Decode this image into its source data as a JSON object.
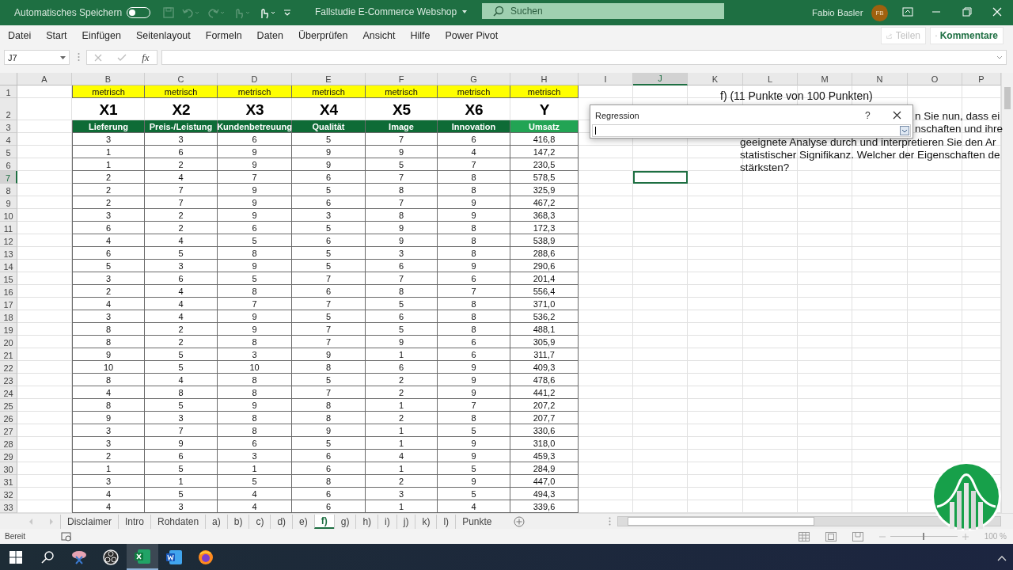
{
  "title_bar": {
    "autosave_label": "Automatisches Speichern",
    "autosave_on": false,
    "document_title": "Fallstudie E-Commerce Webshop",
    "search_placeholder": "Suchen",
    "user_name": "Fabio Basler",
    "user_initials": "FB"
  },
  "menu": [
    "Datei",
    "Start",
    "Einfügen",
    "Seitenlayout",
    "Formeln",
    "Daten",
    "Überprüfen",
    "Ansicht",
    "Hilfe",
    "Power Pivot"
  ],
  "share_button": {
    "label": "Teilen",
    "disabled": true
  },
  "comments_button": {
    "label": "Kommentare"
  },
  "formula_bar": {
    "name_box": "J7",
    "function_label": "fx"
  },
  "columns": [
    {
      "label": "A",
      "selected": false
    },
    {
      "label": "B",
      "selected": false
    },
    {
      "label": "C",
      "selected": false
    },
    {
      "label": "D",
      "selected": false
    },
    {
      "label": "E",
      "selected": false
    },
    {
      "label": "F",
      "selected": false
    },
    {
      "label": "G",
      "selected": false
    },
    {
      "label": "H",
      "selected": false
    },
    {
      "label": "I",
      "selected": false
    },
    {
      "label": "J",
      "selected": true
    },
    {
      "label": "K",
      "selected": false
    },
    {
      "label": "L",
      "selected": false
    },
    {
      "label": "M",
      "selected": false
    },
    {
      "label": "N",
      "selected": false
    },
    {
      "label": "O",
      "selected": false
    },
    {
      "label": "P",
      "selected": false
    }
  ],
  "rows": [
    {
      "label": "1",
      "selected": false
    },
    {
      "label": "2",
      "selected": false
    },
    {
      "label": "3",
      "selected": false
    },
    {
      "label": "4",
      "selected": false
    },
    {
      "label": "5",
      "selected": false
    },
    {
      "label": "6",
      "selected": false
    },
    {
      "label": "7",
      "selected": true
    },
    {
      "label": "8",
      "selected": false
    },
    {
      "label": "9",
      "selected": false
    },
    {
      "label": "10",
      "selected": false
    },
    {
      "label": "11",
      "selected": false
    },
    {
      "label": "12",
      "selected": false
    },
    {
      "label": "13",
      "selected": false
    },
    {
      "label": "14",
      "selected": false
    },
    {
      "label": "15",
      "selected": false
    },
    {
      "label": "16",
      "selected": false
    },
    {
      "label": "17",
      "selected": false
    },
    {
      "label": "18",
      "selected": false
    },
    {
      "label": "19",
      "selected": false
    },
    {
      "label": "20",
      "selected": false
    },
    {
      "label": "21",
      "selected": false
    },
    {
      "label": "22",
      "selected": false
    },
    {
      "label": "23",
      "selected": false
    },
    {
      "label": "24",
      "selected": false
    },
    {
      "label": "25",
      "selected": false
    },
    {
      "label": "26",
      "selected": false
    },
    {
      "label": "27",
      "selected": false
    },
    {
      "label": "28",
      "selected": false
    },
    {
      "label": "29",
      "selected": false
    },
    {
      "label": "30",
      "selected": false
    },
    {
      "label": "31",
      "selected": false
    },
    {
      "label": "32",
      "selected": false
    },
    {
      "label": "33",
      "selected": false
    }
  ],
  "table": {
    "scales": [
      "metrisch",
      "metrisch",
      "metrisch",
      "metrisch",
      "metrisch",
      "metrisch",
      "metrisch"
    ],
    "variables": [
      "X1",
      "X2",
      "X3",
      "X4",
      "X5",
      "X6",
      "Y"
    ],
    "headers": [
      {
        "label": "Lieferung",
        "color": "#0e6b36"
      },
      {
        "label": "Preis-/Leistung",
        "color": "#0e6b36"
      },
      {
        "label": "Kundenbetreuung",
        "color": "#0e6b36"
      },
      {
        "label": "Qualität",
        "color": "#0e6b36"
      },
      {
        "label": "Image",
        "color": "#0e6b36"
      },
      {
        "label": "Innovation",
        "color": "#0e6b36"
      },
      {
        "label": "Umsatz",
        "color": "#22a454"
      }
    ],
    "rows": [
      [
        "3",
        "3",
        "6",
        "5",
        "7",
        "6",
        "416,8"
      ],
      [
        "1",
        "6",
        "9",
        "9",
        "9",
        "4",
        "147,2"
      ],
      [
        "1",
        "2",
        "9",
        "9",
        "5",
        "7",
        "230,5"
      ],
      [
        "2",
        "4",
        "7",
        "6",
        "7",
        "8",
        "578,5"
      ],
      [
        "2",
        "7",
        "9",
        "5",
        "8",
        "8",
        "325,9"
      ],
      [
        "2",
        "7",
        "9",
        "6",
        "7",
        "9",
        "467,2"
      ],
      [
        "3",
        "2",
        "9",
        "3",
        "8",
        "9",
        "368,3"
      ],
      [
        "6",
        "2",
        "6",
        "5",
        "9",
        "8",
        "172,3"
      ],
      [
        "4",
        "4",
        "5",
        "6",
        "9",
        "8",
        "538,9"
      ],
      [
        "6",
        "5",
        "8",
        "5",
        "3",
        "8",
        "288,6"
      ],
      [
        "5",
        "3",
        "9",
        "5",
        "6",
        "9",
        "290,6"
      ],
      [
        "3",
        "6",
        "5",
        "7",
        "7",
        "6",
        "201,4"
      ],
      [
        "2",
        "4",
        "8",
        "6",
        "8",
        "7",
        "556,4"
      ],
      [
        "4",
        "4",
        "7",
        "7",
        "5",
        "8",
        "371,0"
      ],
      [
        "3",
        "4",
        "9",
        "5",
        "6",
        "8",
        "536,2"
      ],
      [
        "8",
        "2",
        "9",
        "7",
        "5",
        "8",
        "488,1"
      ],
      [
        "8",
        "2",
        "8",
        "7",
        "9",
        "6",
        "305,9"
      ],
      [
        "9",
        "5",
        "3",
        "9",
        "1",
        "6",
        "311,7"
      ],
      [
        "10",
        "5",
        "10",
        "8",
        "6",
        "9",
        "409,3"
      ],
      [
        "8",
        "4",
        "8",
        "5",
        "2",
        "9",
        "478,6"
      ],
      [
        "4",
        "8",
        "8",
        "7",
        "2",
        "9",
        "441,2"
      ],
      [
        "8",
        "5",
        "9",
        "8",
        "1",
        "7",
        "207,2"
      ],
      [
        "9",
        "3",
        "8",
        "8",
        "2",
        "8",
        "207,7"
      ],
      [
        "3",
        "7",
        "8",
        "9",
        "1",
        "5",
        "330,6"
      ],
      [
        "3",
        "9",
        "6",
        "5",
        "1",
        "9",
        "318,0"
      ],
      [
        "2",
        "6",
        "3",
        "6",
        "4",
        "9",
        "459,3"
      ],
      [
        "1",
        "5",
        "1",
        "6",
        "1",
        "5",
        "284,9"
      ],
      [
        "3",
        "1",
        "5",
        "8",
        "2",
        "9",
        "447,0"
      ],
      [
        "4",
        "5",
        "4",
        "6",
        "3",
        "5",
        "494,3"
      ],
      [
        "4",
        "3",
        "4",
        "6",
        "1",
        "4",
        "339,6"
      ]
    ]
  },
  "question": {
    "title": "f) (11 Punkte von 100 Punkten)",
    "lines": [
      "n Sie nun, dass ei",
      "nschaften und ihre",
      "geeignete Analyse durch und interpretieren Sie den Ar",
      "statistischer Signifikanz. Welcher der Eigenschaften de",
      "stärksten?"
    ]
  },
  "dialog": {
    "title": "Regression",
    "help": "?"
  },
  "sheet_tabs": [
    {
      "label": "Disclaimer",
      "selected": false
    },
    {
      "label": "Intro",
      "selected": false
    },
    {
      "label": "Rohdaten",
      "selected": false
    },
    {
      "label": "a)",
      "selected": false
    },
    {
      "label": "b)",
      "selected": false
    },
    {
      "label": "c)",
      "selected": false
    },
    {
      "label": "d)",
      "selected": false
    },
    {
      "label": "e)",
      "selected": false
    },
    {
      "label": "f)",
      "selected": true
    },
    {
      "label": "g)",
      "selected": false
    },
    {
      "label": "h)",
      "selected": false
    },
    {
      "label": "i)",
      "selected": false
    },
    {
      "label": "j)",
      "selected": false
    },
    {
      "label": "k)",
      "selected": false
    },
    {
      "label": "l)",
      "selected": false
    },
    {
      "label": "Punkte",
      "selected": false
    }
  ],
  "status_bar": {
    "status": "Bereit",
    "zoom": "100 %",
    "zoom_slider": {
      "level": 0.5
    }
  }
}
